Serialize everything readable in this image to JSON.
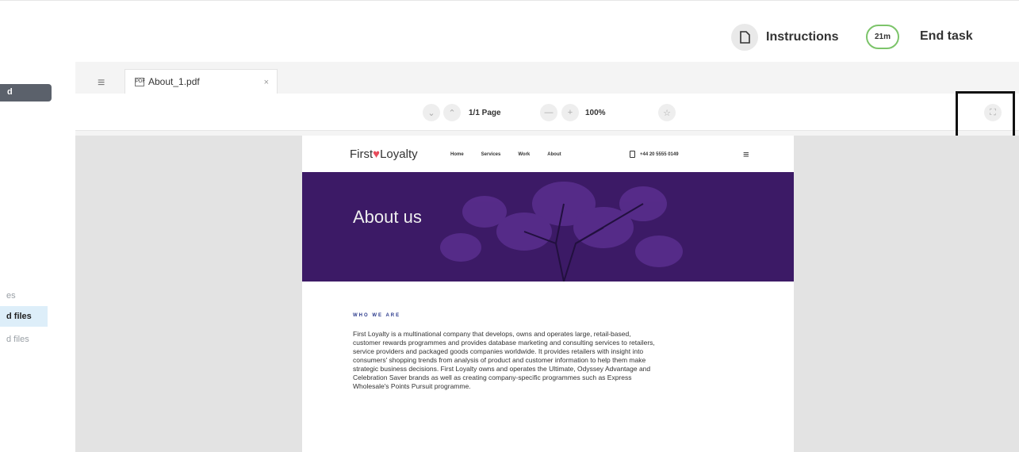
{
  "topbar": {
    "instructions_label": "Instructions",
    "timer_label": "21m",
    "end_task_label": "End task",
    "colors": {
      "timer_ring": "#7cc46a"
    }
  },
  "left_panel": {
    "button_label": "d",
    "items": [
      {
        "label": "es",
        "active": false
      },
      {
        "label": "d files",
        "active": true
      },
      {
        "label": "d files",
        "active": false
      }
    ]
  },
  "viewer": {
    "tab": {
      "filename": "About_1.pdf",
      "close": "×"
    },
    "toolbar": {
      "page_info": "1/1 Page",
      "zoom": "100%"
    }
  },
  "document": {
    "logo": {
      "left": "First",
      "right": "Loyalty"
    },
    "nav": [
      "Home",
      "Services",
      "Work",
      "About"
    ],
    "phone": "+44 20 5555 0149",
    "hero_title": "About us",
    "section_label": "WHO WE ARE",
    "paragraph_lines": [
      "First Loyalty is a multinational company that develops, owns and operates large, retail-based,",
      "customer rewards programmes and provides database marketing and consulting services to retailers,",
      "service providers and packaged goods companies worldwide. It provides retailers with insight into",
      "consumers' shopping trends from analysis of product and customer information to help them make",
      "strategic business decisions. First Loyalty owns and operates the Ultimate, Odyssey Advantage and",
      "Celebration Saver brands as well as creating company-specific programmes such as Express",
      "Wholesale's Points Pursuit programme."
    ],
    "colors": {
      "hero_bg": "#3c1a66",
      "section_label": "#2b3a8c",
      "heart": "#e84c5c"
    }
  }
}
